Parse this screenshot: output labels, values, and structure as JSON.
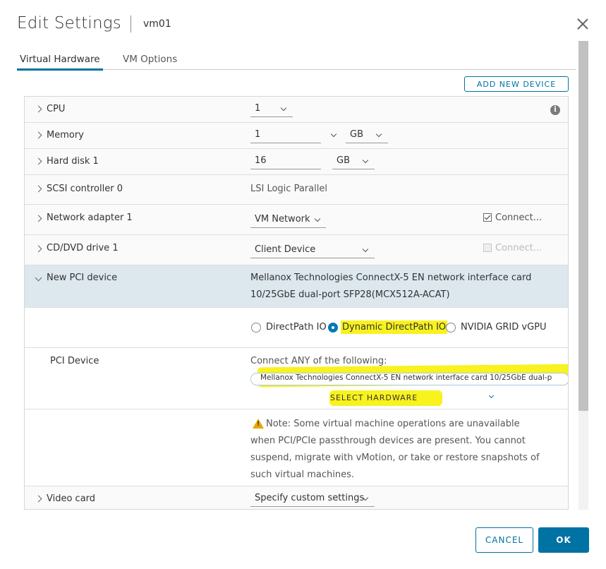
{
  "header": {
    "title": "Edit Settings",
    "vm_name": "vm01"
  },
  "tabs": [
    {
      "label": "Virtual Hardware",
      "active": true
    },
    {
      "label": "VM Options",
      "active": false
    }
  ],
  "add_device_label": "ADD NEW DEVICE",
  "hardware": {
    "cpu": {
      "label": "CPU",
      "value": "1"
    },
    "memory": {
      "label": "Memory",
      "value": "1",
      "unit": "GB"
    },
    "hard_disk": {
      "label": "Hard disk 1",
      "value": "16",
      "unit": "GB"
    },
    "scsi": {
      "label": "SCSI controller 0",
      "value": "LSI Logic Parallel"
    },
    "network": {
      "label": "Network adapter 1",
      "value": "VM Network",
      "connect_label": "Connect...",
      "connected": true
    },
    "cdrom": {
      "label": "CD/DVD drive 1",
      "value": "Client Device",
      "connect_label": "Connect...",
      "connected": false
    },
    "pci": {
      "label": "New PCI device",
      "description_line1": "Mellanox Technologies ConnectX-5 EN network interface card",
      "description_line2": "10/25GbE dual-port SFP28(MCX512A-ACAT)",
      "io_options": [
        "DirectPath IO",
        "Dynamic DirectPath IO",
        "NVIDIA GRID vGPU"
      ],
      "io_selected": "Dynamic DirectPath IO",
      "device_label": "PCI Device",
      "connect_any": "Connect ANY of the following:",
      "device_chip": "Mellanox Technologies ConnectX-5 EN network interface card 10/25GbE dual-p",
      "select_hardware": "SELECT HARDWARE",
      "note": "Note: Some virtual machine operations are unavailable when PCI/PCIe passthrough devices are present. You cannot suspend, migrate with vMotion, or take or restore snapshots of such virtual machines."
    },
    "video": {
      "label": "Video card",
      "value": "Specify custom settings"
    }
  },
  "footer": {
    "cancel_label": "CANCEL",
    "ok_label": "OK"
  },
  "colors": {
    "accent": "#0072a3",
    "highlight": "#f8f21e",
    "selected_row": "#dce7ee"
  }
}
